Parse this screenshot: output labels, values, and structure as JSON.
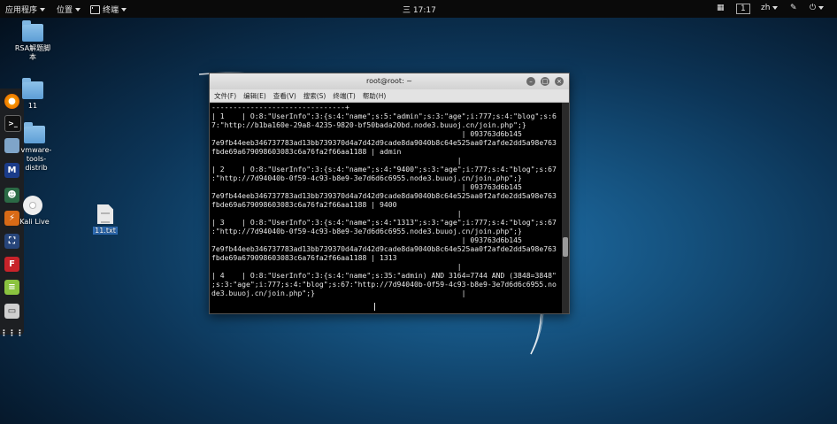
{
  "topbar": {
    "apps_label": "应用程序",
    "places_label": "位置",
    "terminal_label": "终端",
    "clock": "三 17:17",
    "workspace": "1",
    "lang": "zh"
  },
  "desktop": {
    "icons": [
      {
        "label": "RSA解题脚\n本"
      },
      {
        "label": "11"
      },
      {
        "label": "vmware-\ntools-distrib"
      },
      {
        "label": "Kali Live"
      },
      {
        "label": "11.txt"
      }
    ]
  },
  "dock": {
    "icons": [
      "firefox-icon",
      "terminal-icon",
      "folder-icon",
      "metasploit-icon",
      "kali-user-icon",
      "burp-icon",
      "maltego-icon",
      "faraday-icon",
      "notes-icon",
      "cherrytree-icon",
      "show-apps-icon"
    ]
  },
  "window": {
    "title": "root@root: ~",
    "menu": [
      "文件(F)",
      "编辑(E)",
      "查看(V)",
      "搜索(S)",
      "终端(T)",
      "帮助(H)"
    ],
    "terminal_text": "-------------------------------+\n| 1    | O:8:\"UserInfo\":3:{s:4:\"name\";s:5:\"admin\";s:3:\"age\";i:777;s:4:\"blog\";s:6\n7:\"http://b1ba160e-29a8-4235-9820-bf50bada20bd.node3.buuoj.cn/join.php\";}\n                                                          | 093763d6b145\n7e9fb44eeb346737783ad13bb739370d4a7d42d9cade8da9040b8c64e525aa0f2afde2dd5a98e763\nfbde69a679098603083c6a76fa2f66aa1188 | admin\n                                                         |\n| 2    | O:8:\"UserInfo\":3:{s:4:\"name\";s:4:\"9400\";s:3:\"age\";i:777;s:4:\"blog\";s:67\n:\"http://7d94040b-0f59-4c93-b8e9-3e7d6d6c6955.node3.buuoj.cn/join.php\";}\n                                                          | 093763d6b145\n7e9fb44eeb346737783ad13bb739370d4a7d42d9cade8da9040b8c64e525aa0f2afde2dd5a98e763\nfbde69a679098603083c6a76fa2f66aa1188 | 9400\n                                                         |\n| 3    | O:8:\"UserInfo\":3:{s:4:\"name\";s:4:\"1313\";s:3:\"age\";i:777;s:4:\"blog\";s:67\n:\"http://7d94040b-0f59-4c93-b8e9-3e7d6d6c6955.node3.buuoj.cn/join.php\";}\n                                                          | 093763d6b145\n7e9fb44eeb346737783ad13bb739370d4a7d42d9cade8da9040b8c64e525aa0f2afde2dd5a98e763\nfbde69a679098603083c6a76fa2f66aa1188 | 1313\n                                                         |\n| 4    | O:8:\"UserInfo\":3:{s:4:\"name\";s:35:\"admin) AND 3164=7744 AND (3848=3848\"\n;s:3:\"age\";i:777;s:4:\"blog\";s:67:\"http://7d94040b-0f59-4c93-b8e9-3e7d6d6c6955.no\nde3.buuoj.cn/join.php\";}                                  |"
  }
}
